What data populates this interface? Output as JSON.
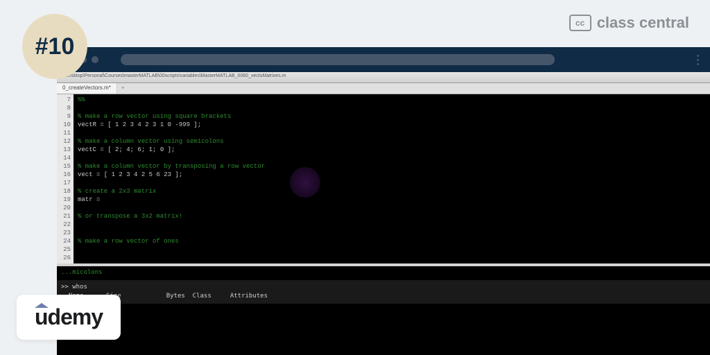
{
  "badge": "#10",
  "cc_logo": {
    "icon_text": "cc",
    "text": "class central"
  },
  "toolbar_path": "...Desktop\\Personal\\Courses\\masterMATLAB\\00scripts\\variables\\MasterMATLAB_0060_vectsMatrixes.m",
  "tab_name": "0_createVectors.m*",
  "line_numbers": [
    "7",
    "8",
    "9",
    "10",
    "11",
    "12",
    "13",
    "14",
    "15",
    "16",
    "17",
    "18",
    "19",
    "20",
    "21",
    "22",
    "23",
    "24",
    "25",
    "26"
  ],
  "code_lines": [
    {
      "type": "comment",
      "text": "%%"
    },
    {
      "type": "blank",
      "text": ""
    },
    {
      "type": "comment",
      "text": "% make a row vector using square brackets"
    },
    {
      "type": "code",
      "text": "vectR = [ 1 2 3 4 2 3 1 0 -999 ];"
    },
    {
      "type": "blank",
      "text": ""
    },
    {
      "type": "comment",
      "text": "% make a column vector using semicolons"
    },
    {
      "type": "code",
      "text": "vectC = [ 2; 4; 6; 1; 0 ];"
    },
    {
      "type": "blank",
      "text": ""
    },
    {
      "type": "comment",
      "text": "% make a column vector by transposing a row vector"
    },
    {
      "type": "code",
      "text": "vect = [ 1 2 3 4 2 5 6 23 ];"
    },
    {
      "type": "blank",
      "text": ""
    },
    {
      "type": "comment",
      "text": "% create a 2x3 matrix"
    },
    {
      "type": "code",
      "text": "matr ="
    },
    {
      "type": "blank",
      "text": ""
    },
    {
      "type": "comment",
      "text": "% or transpose a 3x2 matrix!"
    },
    {
      "type": "blank",
      "text": ""
    },
    {
      "type": "blank",
      "text": ""
    },
    {
      "type": "comment",
      "text": "% make a row vector of ones"
    },
    {
      "type": "blank",
      "text": ""
    },
    {
      "type": "blank",
      "text": ""
    }
  ],
  "console_header": "...micolons",
  "console_prompt": ">> whos",
  "console_columns": "  Name      Size            Bytes  Class     Attributes",
  "udemy": "udemy"
}
